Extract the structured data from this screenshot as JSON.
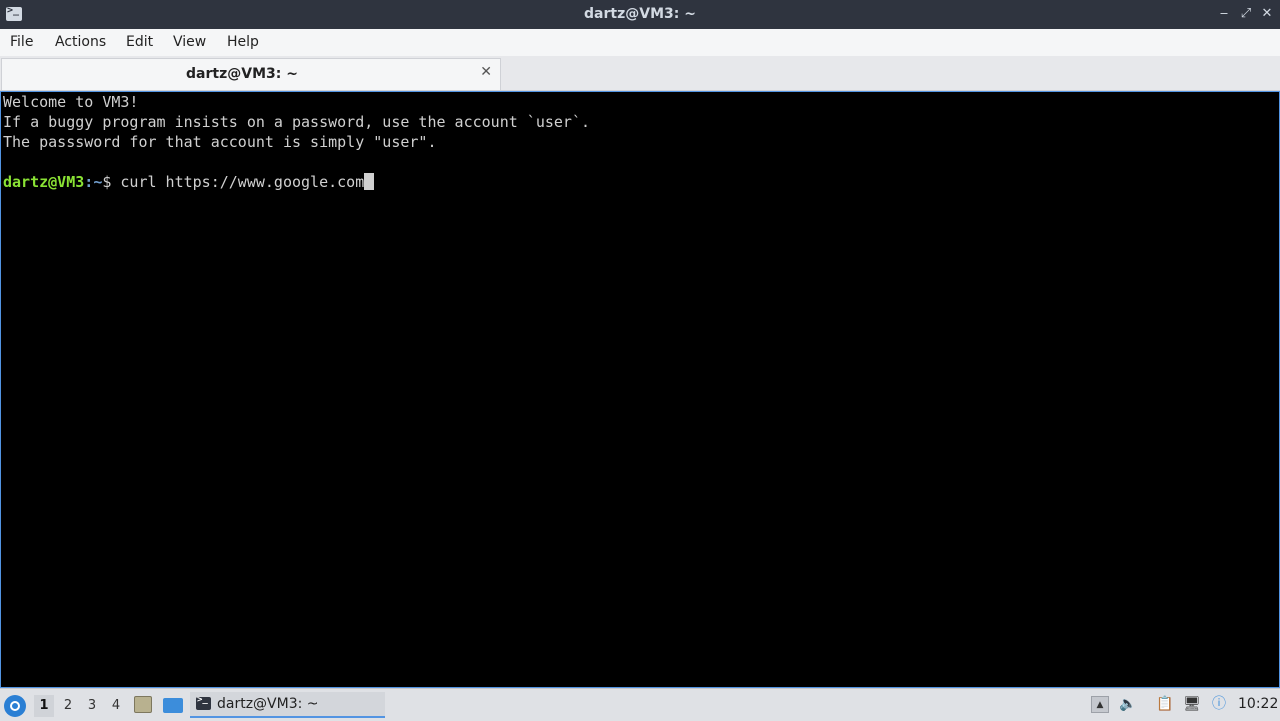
{
  "window": {
    "title": "dartz@VM3: ~",
    "minimize": "‒",
    "maximize": "⤢",
    "close": "✕"
  },
  "menubar": {
    "items": [
      "File",
      "Actions",
      "Edit",
      "View",
      "Help"
    ]
  },
  "tabs": [
    {
      "label": "dartz@VM3: ~",
      "close": "✕"
    }
  ],
  "terminal": {
    "lines": [
      "Welcome to VM3!",
      "If a buggy program insists on a password, use the account `user`.",
      "The passsword for that account is simply \"user\"."
    ],
    "prompt_user": "dartz@VM3",
    "prompt_sep": ":",
    "prompt_path": "~",
    "prompt_symbol": "$ ",
    "command": "curl https://www.google.com"
  },
  "taskbar": {
    "desktops": [
      "1",
      "2",
      "3",
      "4"
    ],
    "active_desktop": "1",
    "task_label": "dartz@VM3: ~",
    "clock": "10:22",
    "tray_icons": [
      "tray-expand-icon",
      "volume-icon",
      "clipboard-icon",
      "network-icon",
      "update-notifier-icon"
    ]
  },
  "colors": {
    "titlebar": "#2f343f",
    "accent": "#5294e2",
    "prompt_user": "#8ae234",
    "prompt_path": "#729fcf",
    "terminal_bg": "#000000"
  }
}
